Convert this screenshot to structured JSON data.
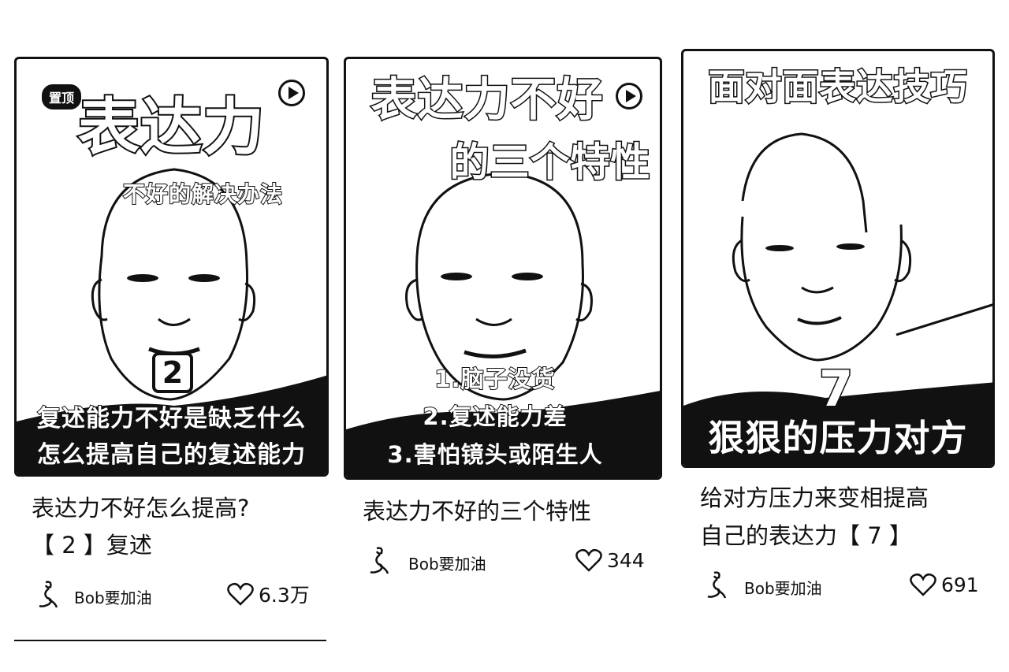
{
  "cards": [
    {
      "cover": {
        "pin_label": "置顶",
        "headline": "表达力",
        "subheadline": "不好的解决办法",
        "episode_number": "2",
        "caption_lines": [
          "复述能力不好是缺乏什么",
          "怎么提高自己的复述能力"
        ]
      },
      "title_line1": "表达力不好怎么提高?",
      "title_line2": "【 2 】复述",
      "author": "Bob要加油",
      "likes": "6.3万"
    },
    {
      "cover": {
        "headline": "表达力不好",
        "subheadline": "的三个特性",
        "caption_lines": [
          "1.脑子没货",
          "2.复述能力差",
          "3.害怕镜头或陌生人"
        ]
      },
      "title_line1": "表达力不好的三个特性",
      "author": "Bob要加油",
      "likes": "344"
    },
    {
      "cover": {
        "headline": "面对面表达技巧",
        "episode_number": "7",
        "caption_lines": [
          "狠狠的压力对方"
        ]
      },
      "title_line1": "给对方压力来变相提高",
      "title_line2": "自己的表达力【 7 】",
      "author": "Bob要加油",
      "likes": "691"
    }
  ],
  "colors": {
    "ink": "#111111",
    "background": "#ffffff"
  },
  "icons": [
    "play-icon",
    "heart-icon",
    "avatar-icon"
  ]
}
